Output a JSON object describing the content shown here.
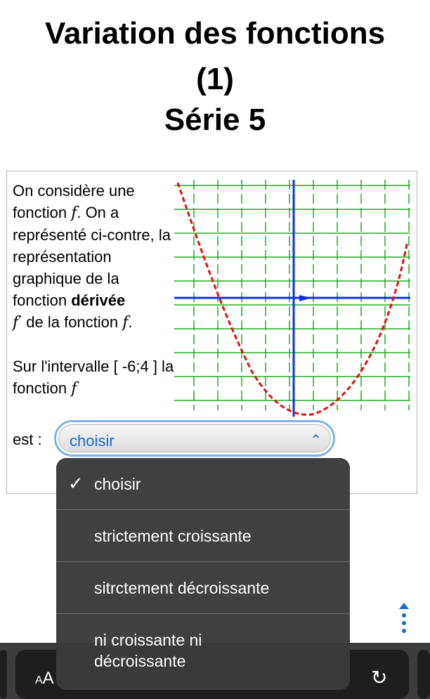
{
  "title": {
    "line1": "Variation des fonctions",
    "line2": "(1)",
    "line3": "Série 5"
  },
  "exercise": {
    "intro": "On considère une fonction",
    "f": "f",
    "intro_after_f": ". On a représenté ci-contre, la représentation graphique de la fonction",
    "derivee": "dérivée",
    "fprime": "f′",
    "de_la_fonction": "de la fonction",
    "f_end": "f",
    "period": ".",
    "question": "Sur l'intervalle [ -6;4 ] la fonction",
    "est": "est :"
  },
  "select": {
    "value": "choisir",
    "arrows": "⌃⌄"
  },
  "dropdown": {
    "options": [
      {
        "label": "choisir",
        "selected": true
      },
      {
        "label": "strictement croissante",
        "selected": false
      },
      {
        "label": "sitrctement décroissante",
        "selected": false
      },
      {
        "label": "ni croissante ni décroissante",
        "selected": false
      }
    ],
    "check": "✓"
  },
  "toolbar": {
    "text_size": "AA",
    "reload_icon": "reload-icon"
  },
  "colors": {
    "grid": "#22aa22",
    "axis": "#1030e0",
    "curve": "#e01010",
    "select_border": "#7db2ea"
  }
}
